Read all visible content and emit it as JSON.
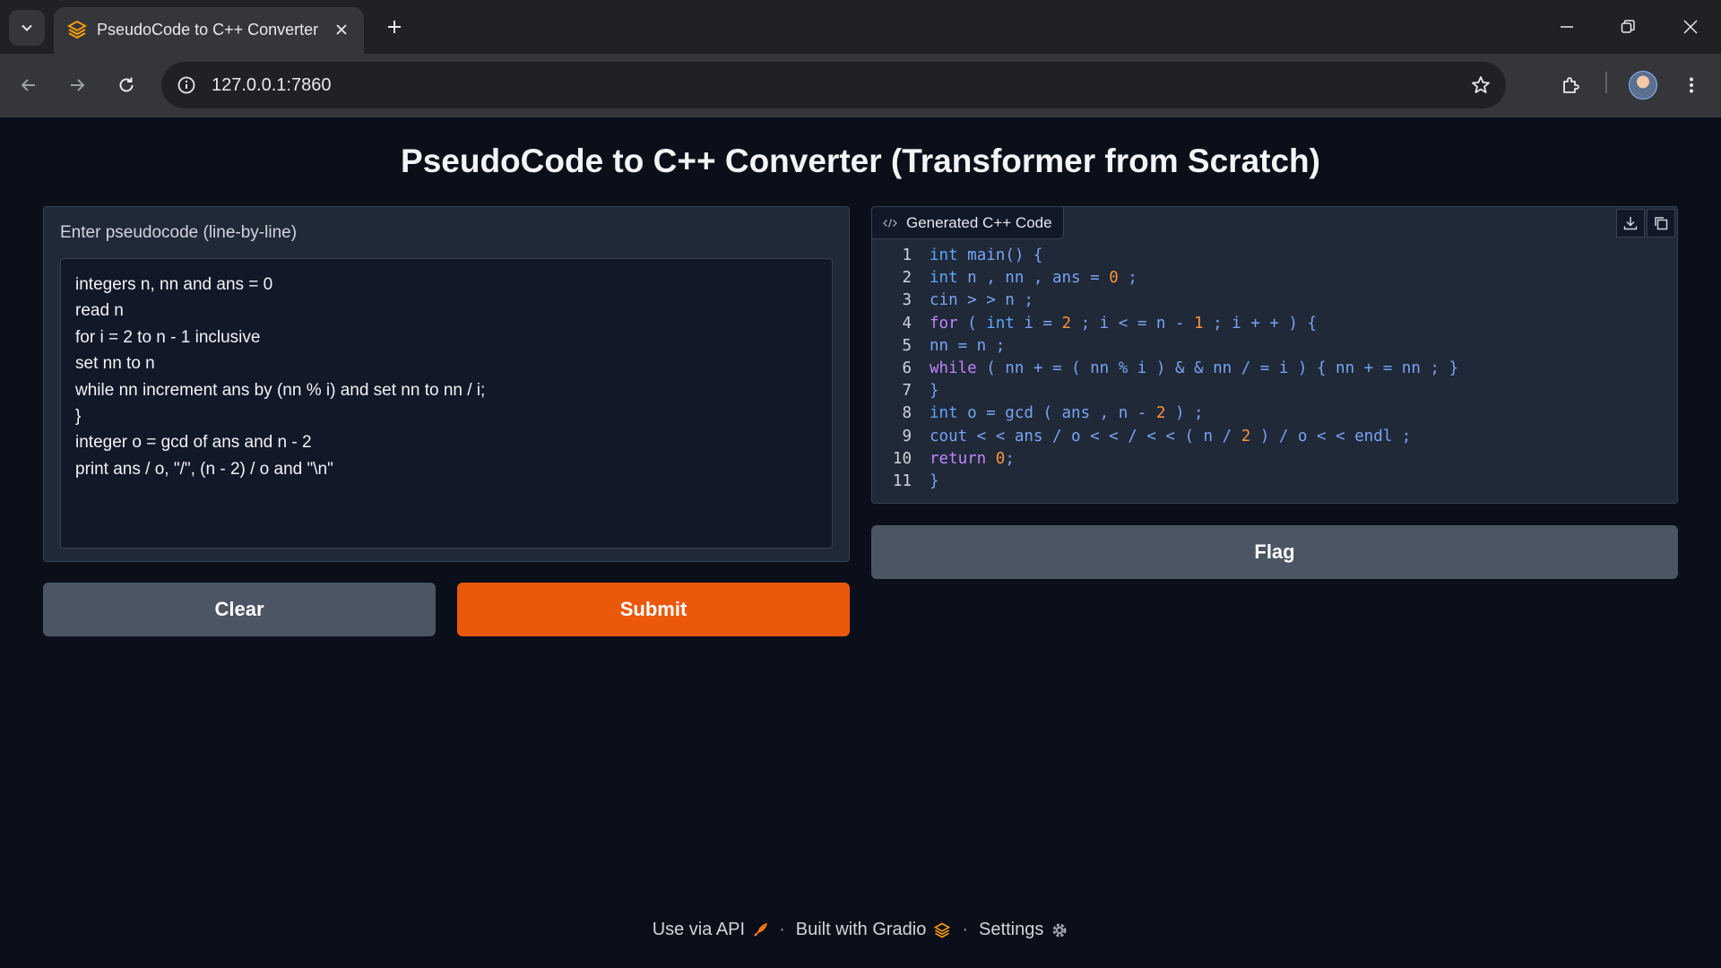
{
  "browser": {
    "tab_title": "PseudoCode to C++ Converter",
    "url": "127.0.0.1:7860"
  },
  "app": {
    "title": "PseudoCode to C++ Converter (Transformer from Scratch)",
    "input_label": "Enter pseudocode (line-by-line)",
    "pseudocode_lines": [
      "integers n, nn and ans = 0",
      "read n",
      "for i = 2 to n - 1 inclusive",
      "set nn to n",
      "while nn increment ans by (nn % i) and set nn to nn / i;",
      "}",
      "integer o = gcd of ans and n - 2",
      "print ans / o, \"/\", (n - 2) / o and \"\\n\""
    ],
    "output_label": "Generated C++ Code",
    "code_lines": [
      [
        [
          "ty",
          "int "
        ],
        [
          "fn",
          "main"
        ],
        [
          "pl",
          "() {"
        ]
      ],
      [
        [
          "ty",
          "int "
        ],
        [
          "pl",
          "n , nn , ans = "
        ],
        [
          "num",
          "0"
        ],
        [
          "pl",
          " ;"
        ]
      ],
      [
        [
          "pl",
          "cin > > n ;"
        ]
      ],
      [
        [
          "kw",
          "for"
        ],
        [
          "pl",
          " ( "
        ],
        [
          "ty",
          "int"
        ],
        [
          "pl",
          " i = "
        ],
        [
          "num",
          "2"
        ],
        [
          "pl",
          " ; i < = n - "
        ],
        [
          "num",
          "1"
        ],
        [
          "pl",
          " ; i + + ) {"
        ]
      ],
      [
        [
          "pl",
          "nn = n ;"
        ]
      ],
      [
        [
          "kw",
          "while"
        ],
        [
          "pl",
          " ( nn + = ( nn % i ) & & nn / = i ) { nn + = nn ; }"
        ]
      ],
      [
        [
          "pl",
          "}"
        ]
      ],
      [
        [
          "ty",
          "int "
        ],
        [
          "pl",
          "o = gcd ( ans , n - "
        ],
        [
          "num",
          "2"
        ],
        [
          "pl",
          " ) ;"
        ]
      ],
      [
        [
          "pl",
          "cout < < ans / o < < / < < ( n / "
        ],
        [
          "num",
          "2"
        ],
        [
          "pl",
          " ) / o < < endl ;"
        ]
      ],
      [
        [
          "kw",
          "return"
        ],
        [
          "pl",
          " "
        ],
        [
          "num",
          "0"
        ],
        [
          "pl",
          ";"
        ]
      ],
      [
        [
          "pl",
          "}"
        ]
      ]
    ],
    "buttons": {
      "clear": "Clear",
      "submit": "Submit",
      "flag": "Flag"
    },
    "footer": {
      "api": "Use via API",
      "built_with": "Built with Gradio",
      "settings": "Settings"
    }
  },
  "colors": {
    "accent": "#ea580c",
    "background": "#0b0f19",
    "panel": "#1f2937"
  }
}
